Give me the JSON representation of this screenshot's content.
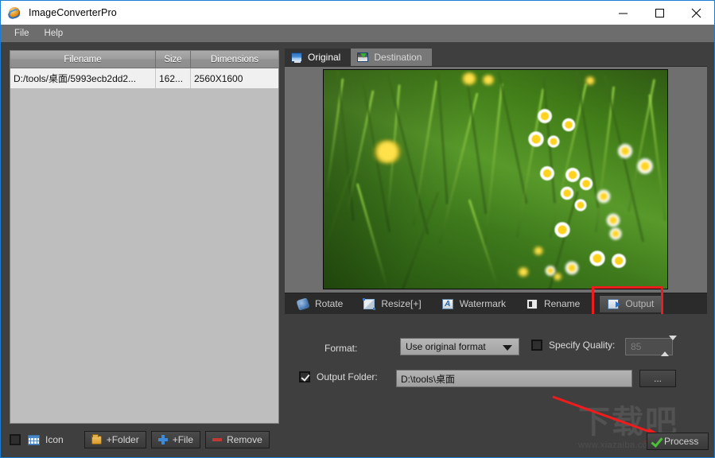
{
  "window": {
    "title": "ImageConverterPro",
    "icon": "app-globe-icon",
    "minimize": "–",
    "maximize": "□",
    "close": "✕"
  },
  "menubar": {
    "items": [
      {
        "label": "File"
      },
      {
        "label": "Help"
      }
    ]
  },
  "file_list": {
    "columns": [
      "Filename",
      "Size",
      "Dimensions"
    ],
    "rows": [
      {
        "filename": "D:/tools/桌面/5993ecb2dd2...",
        "size": "162...",
        "dimensions": "2560X1600"
      }
    ]
  },
  "bottom_bar": {
    "icon_checkbox_checked": false,
    "icon_label": "Icon",
    "buttons": [
      {
        "label": "+Folder",
        "icon": "folder-icon"
      },
      {
        "label": "+File",
        "icon": "plus-icon"
      },
      {
        "label": "Remove",
        "icon": "minus-icon"
      }
    ]
  },
  "preview": {
    "tabs": [
      {
        "label": "Original",
        "icon": "monitor-icon",
        "active": true
      },
      {
        "label": "Destination",
        "icon": "destination-icon",
        "active": false
      }
    ],
    "image_alt": "Close-up photo of green grass with white daisies and yellow buttercups"
  },
  "toolbar": {
    "items": [
      {
        "label": "Rotate",
        "icon": "rotate-icon",
        "selected": false
      },
      {
        "label": "Resize[+]",
        "icon": "resize-icon",
        "selected": false
      },
      {
        "label": "Watermark",
        "icon": "watermark-icon",
        "selected": false
      },
      {
        "label": "Rename",
        "icon": "rename-icon",
        "selected": false
      },
      {
        "label": "Output",
        "icon": "output-icon",
        "selected": true
      }
    ],
    "highlight_color": "#ee1c1c"
  },
  "output_panel": {
    "format_label": "Format:",
    "format_value": "Use original format",
    "specify_quality_label": "Specify Quality:",
    "specify_quality_checked": false,
    "quality_value": "85",
    "quality_enabled": false,
    "output_folder_label": "Output Folder:",
    "output_folder_checked": true,
    "output_folder_value": "D:\\tools\\桌面",
    "browse_label": "..."
  },
  "process": {
    "label": "Process",
    "icon": "green-check-icon",
    "check_color": "#49c236"
  },
  "watermark": {
    "text_cn": "下载吧",
    "url": "www.xiazaiba.com"
  },
  "colors": {
    "window_border": "#1a7fd4",
    "panel_bg": "#3f3f3f",
    "toolbar_bg": "#2b2b2b",
    "menubar_bg": "#6d6d6d",
    "list_bg": "#bebebe",
    "annotation_red": "#ee1c1c"
  }
}
